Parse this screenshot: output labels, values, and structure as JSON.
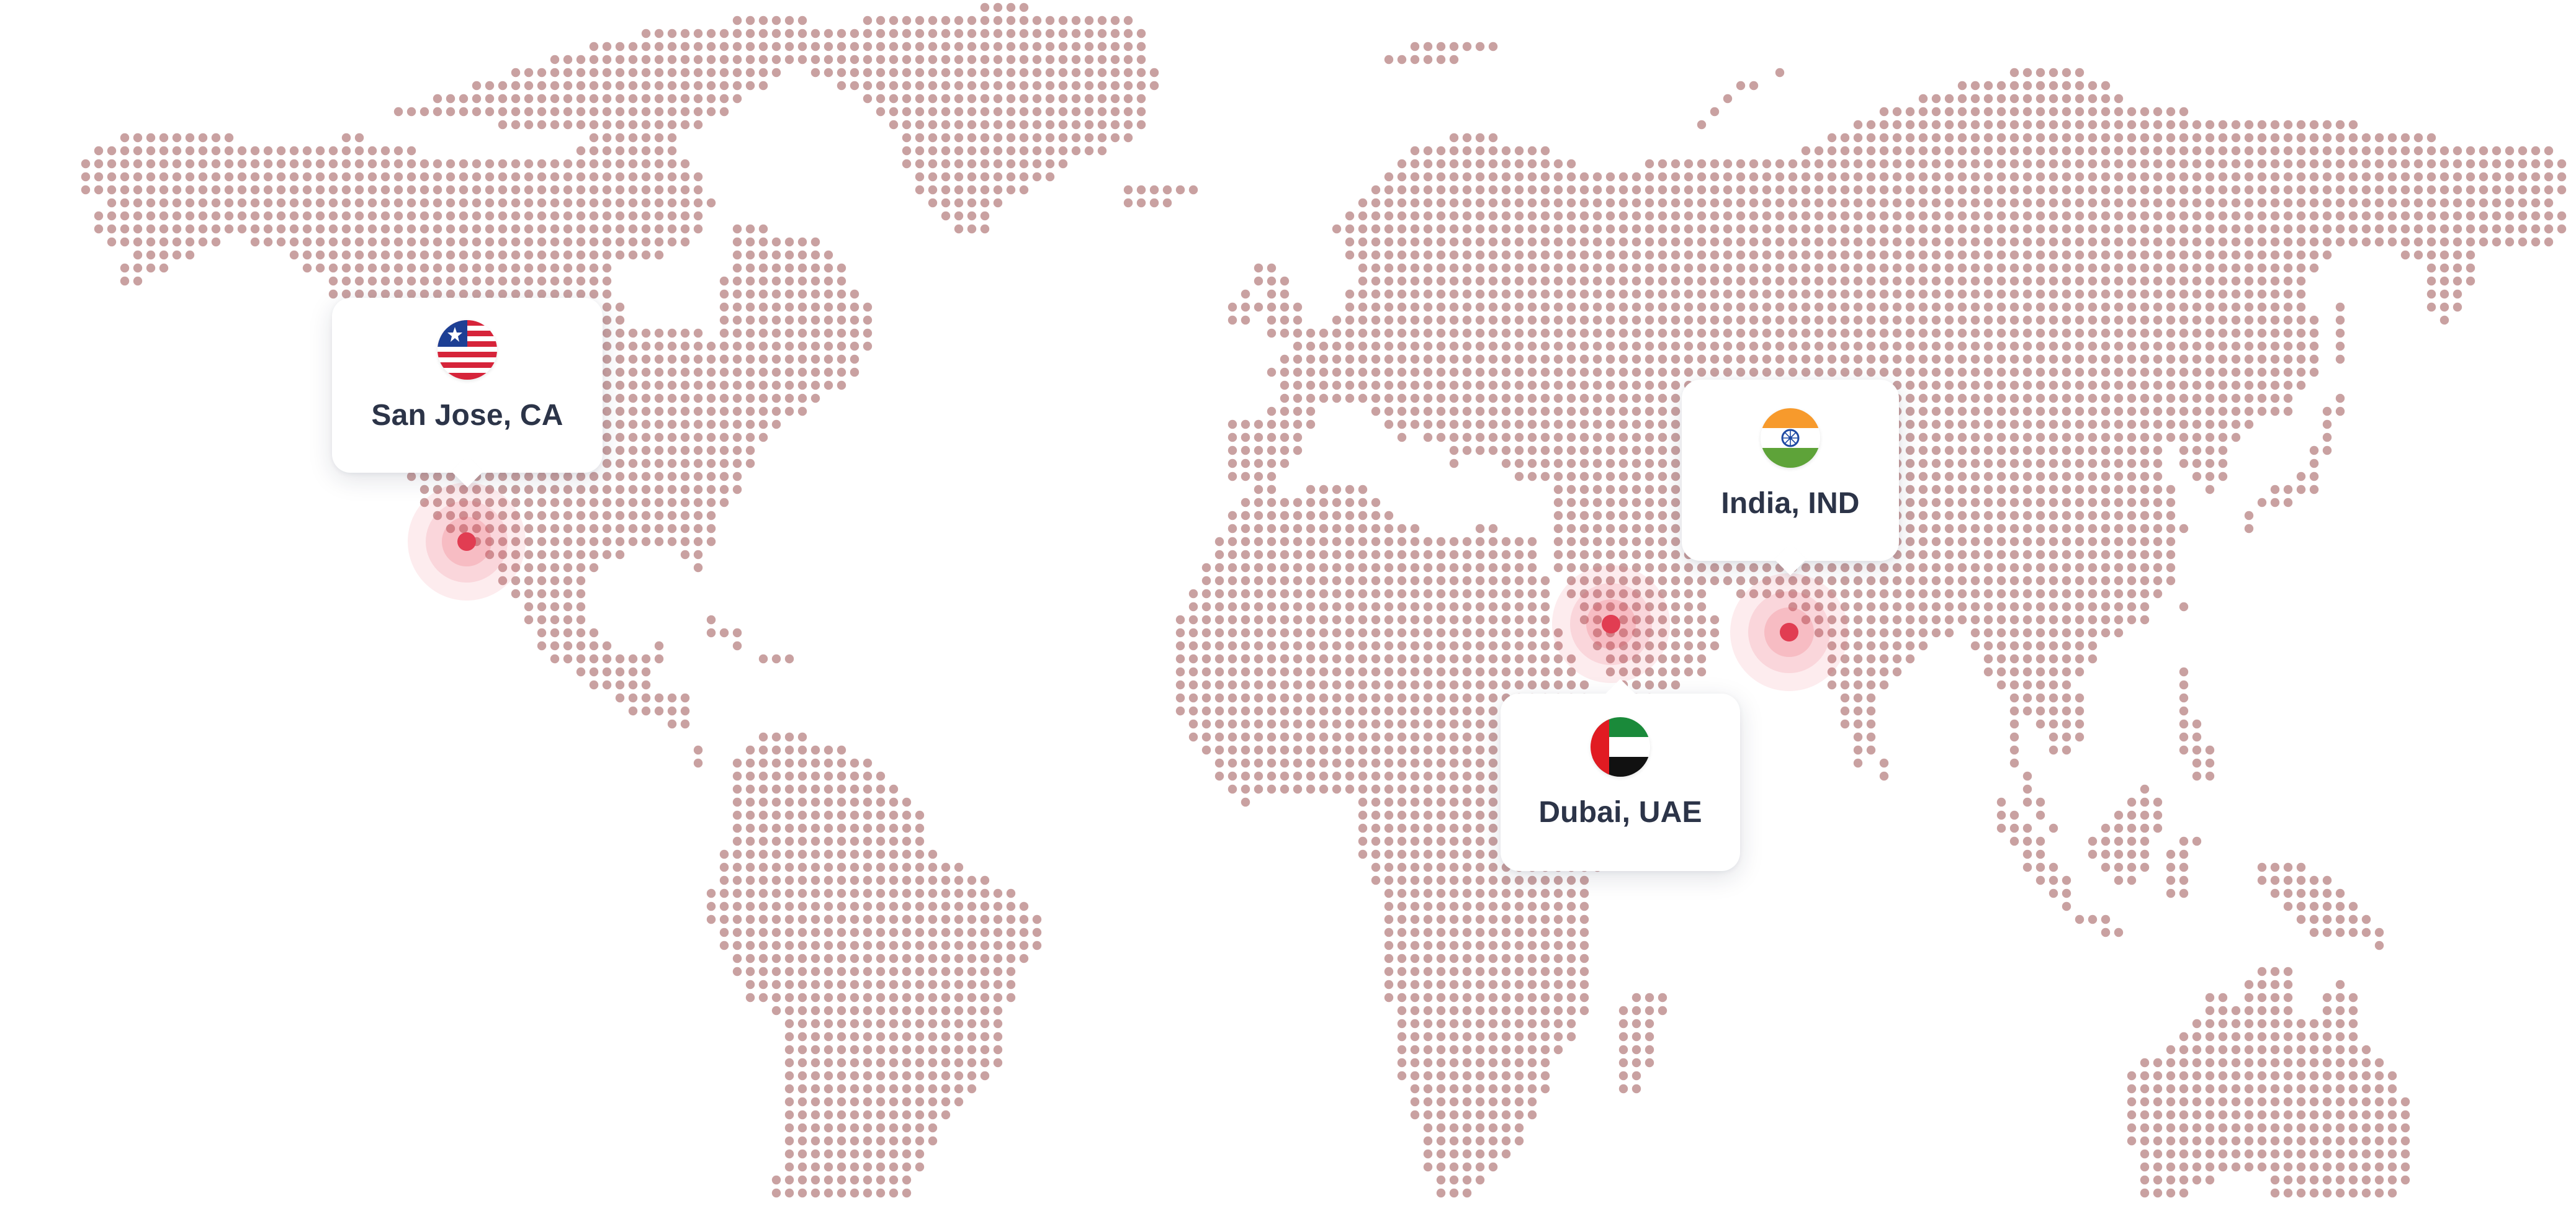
{
  "map": {
    "dot_color": "#c9a1a1",
    "pin_color": "#e13d52",
    "background": "#ffffff"
  },
  "locations": [
    {
      "id": "san-jose",
      "label": "San Jose, CA",
      "flag": "us-flag-icon",
      "lon": -121.9,
      "lat": 37.3
    },
    {
      "id": "india",
      "label": "India, IND",
      "flag": "india-flag-icon",
      "lon": 78.5,
      "lat": 17.4
    },
    {
      "id": "dubai",
      "label": "Dubai, UAE",
      "flag": "uae-flag-icon",
      "lon": 55.3,
      "lat": 25.2
    }
  ]
}
